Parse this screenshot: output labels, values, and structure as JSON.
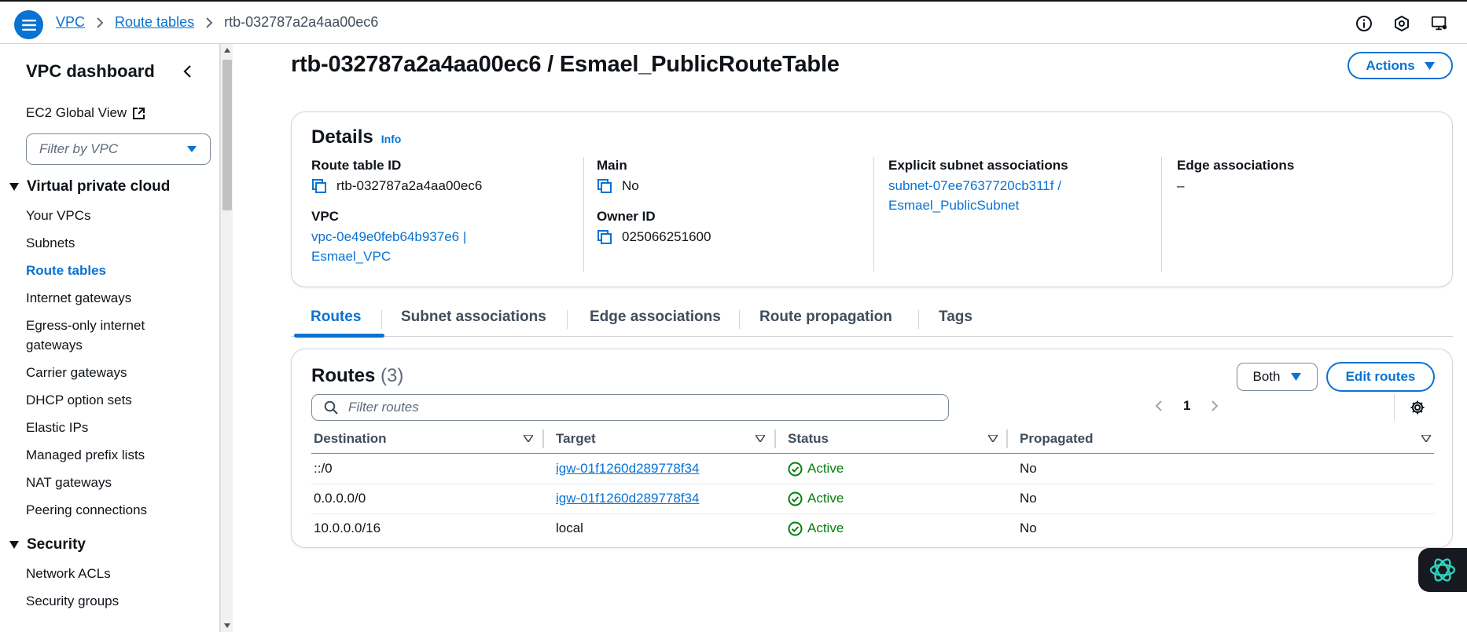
{
  "breadcrumb": {
    "items": [
      "VPC",
      "Route tables"
    ],
    "current": "rtb-032787a2a4aa00ec6"
  },
  "sidebar": {
    "title": "VPC dashboard",
    "ec2_global_view": "EC2 Global View",
    "filter_placeholder": "Filter by VPC",
    "sections": [
      {
        "label": "Virtual private cloud",
        "items": [
          "Your VPCs",
          "Subnets",
          "Route tables",
          "Internet gateways",
          "Egress-only internet gateways",
          "Carrier gateways",
          "DHCP option sets",
          "Elastic IPs",
          "Managed prefix lists",
          "NAT gateways",
          "Peering connections"
        ]
      },
      {
        "label": "Security",
        "items": [
          "Network ACLs",
          "Security groups"
        ]
      }
    ],
    "active_item": "Route tables"
  },
  "page": {
    "title": "rtb-032787a2a4aa00ec6 / Esmael_PublicRouteTable",
    "actions_label": "Actions"
  },
  "details": {
    "heading": "Details",
    "info": "Info",
    "route_table_id_label": "Route table ID",
    "route_table_id": "rtb-032787a2a4aa00ec6",
    "vpc_label": "VPC",
    "vpc_line1": "vpc-0e49e0feb64b937e6 |",
    "vpc_line2": "Esmael_VPC",
    "main_label": "Main",
    "main_value": "No",
    "owner_label": "Owner ID",
    "owner_value": "025066251600",
    "explicit_label": "Explicit subnet associations",
    "explicit_line1": "subnet-07ee7637720cb311f /",
    "explicit_line2": "Esmael_PublicSubnet",
    "edge_label": "Edge associations",
    "edge_value": "–"
  },
  "tabs": [
    "Routes",
    "Subnet associations",
    "Edge associations",
    "Route propagation",
    "Tags"
  ],
  "routes": {
    "heading": "Routes",
    "count": "(3)",
    "filter_label": "Both",
    "edit_label": "Edit routes",
    "search_placeholder": "Filter routes",
    "page": "1",
    "columns": [
      "Destination",
      "Target",
      "Status",
      "Propagated"
    ],
    "rows": [
      {
        "destination": "::/0",
        "target": "igw-01f1260d289778f34",
        "status": "Active",
        "propagated": "No"
      },
      {
        "destination": "0.0.0.0/0",
        "target": "igw-01f1260d289778f34",
        "status": "Active",
        "propagated": "No"
      },
      {
        "destination": "10.0.0.0/16",
        "target": "local",
        "status": "Active",
        "propagated": "No"
      }
    ]
  },
  "colors": {
    "accent": "#0972d3",
    "success": "#037f0c",
    "text": "#0f141a"
  }
}
